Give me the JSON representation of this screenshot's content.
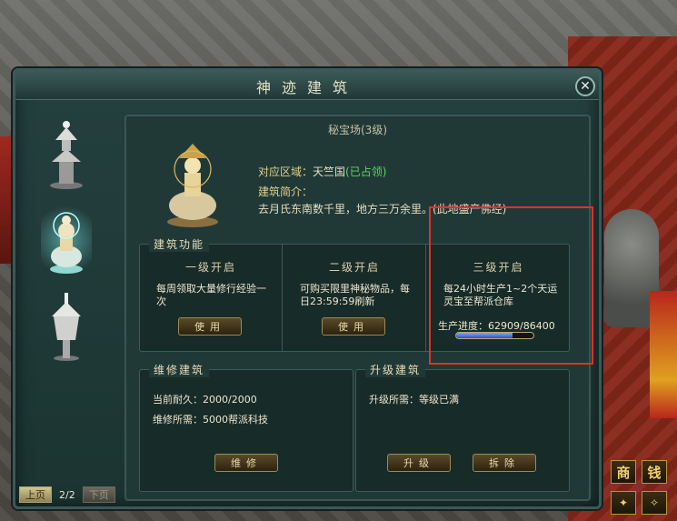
{
  "window": {
    "title": "神迹建筑",
    "close_label": "✕"
  },
  "buildings": [
    {
      "name": "pagoda-tower"
    },
    {
      "name": "buddha-elephant-statue",
      "selected": true
    },
    {
      "name": "silver-lantern"
    }
  ],
  "pager": {
    "prev": "上页",
    "page": "2/2",
    "next": "下页"
  },
  "detail": {
    "building_name": "秘宝场(3级)",
    "region_label": "对应区域：",
    "region_value": "天竺国",
    "region_status": "(已占领)",
    "intro_label": "建筑简介：",
    "intro_text": "去月氏东南数千里，地方三万余里。(此地盛产佛经)"
  },
  "functions": {
    "title": "建筑功能",
    "items": [
      {
        "head": "一级开启",
        "desc": "每周领取大量修行经验一次",
        "button": "使用"
      },
      {
        "head": "二级开启",
        "desc": "可购买限里神秘物品，每日23:59:59刷新",
        "button": "使用"
      },
      {
        "head": "三级开启",
        "desc": "每24小时生产1~2个天运灵宝至帮派仓库",
        "progress_label": "生产进度：62909/86400",
        "progress_value": 62909,
        "progress_max": 86400
      }
    ]
  },
  "repair": {
    "title": "维修建筑",
    "durability": "当前耐久：2000/2000",
    "cost": "维修所需：5000帮派科技",
    "button": "维修"
  },
  "upgrade": {
    "title": "升级建筑",
    "requirement": "升级所需：等级已满",
    "upgrade_button": "升级",
    "demolish_button": "拆除"
  },
  "side_buttons": [
    "商",
    "钱"
  ],
  "colors": {
    "highlight_box": "#e0322a",
    "progress_fill": "#4a6ee0",
    "status_green": "#58d858"
  }
}
